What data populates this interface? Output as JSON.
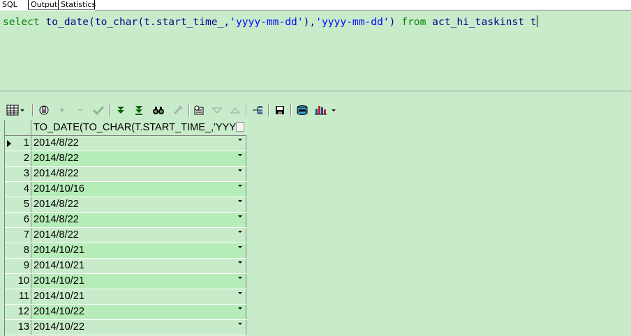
{
  "tabs": [
    {
      "label": "SQL"
    },
    {
      "label": "Output"
    },
    {
      "label": "Statistics"
    }
  ],
  "sql": {
    "keyword_select": "select",
    "fn_to_date": "to_date",
    "fn_to_char": "to_char",
    "expr_col": "t.start_time_",
    "fmt1": "'yyyy-mm-dd'",
    "fmt2": "'yyyy-mm-dd'",
    "keyword_from": "from",
    "table": "act_hi_taskinst",
    "alias": "t"
  },
  "toolbar": {
    "icons": [
      "grid-menu-icon",
      "lock-icon",
      "add-record-icon",
      "delete-record-icon",
      "post-edit-icon",
      "fetch-next-icon",
      "fetch-last-icon",
      "find-icon",
      "clear-icon",
      "query-by-example-icon",
      "sort-desc-icon",
      "sort-asc-icon",
      "link-icon",
      "save-icon",
      "export-icon",
      "chart-menu-icon"
    ]
  },
  "grid": {
    "column_header": "TO_DATE(TO_CHAR(T.START_TIME_,'YYYY-MM-DD'),'YYYY-MM-DD')",
    "rows": [
      {
        "n": "1",
        "value": "2014/8/22"
      },
      {
        "n": "2",
        "value": "2014/8/22"
      },
      {
        "n": "3",
        "value": "2014/8/22"
      },
      {
        "n": "4",
        "value": "2014/10/16"
      },
      {
        "n": "5",
        "value": "2014/8/22"
      },
      {
        "n": "6",
        "value": "2014/8/22"
      },
      {
        "n": "7",
        "value": "2014/8/22"
      },
      {
        "n": "8",
        "value": "2014/10/21"
      },
      {
        "n": "9",
        "value": "2014/10/21"
      },
      {
        "n": "10",
        "value": "2014/10/21"
      },
      {
        "n": "11",
        "value": "2014/10/21"
      },
      {
        "n": "12",
        "value": "2014/10/22"
      },
      {
        "n": "13",
        "value": "2014/10/22"
      }
    ]
  },
  "colors": {
    "background": "#c8ecca",
    "alt_row": "#b6ecb8",
    "sql_keyword": "#008000",
    "sql_identifier": "#00008b",
    "sql_string": "#0000ff"
  }
}
